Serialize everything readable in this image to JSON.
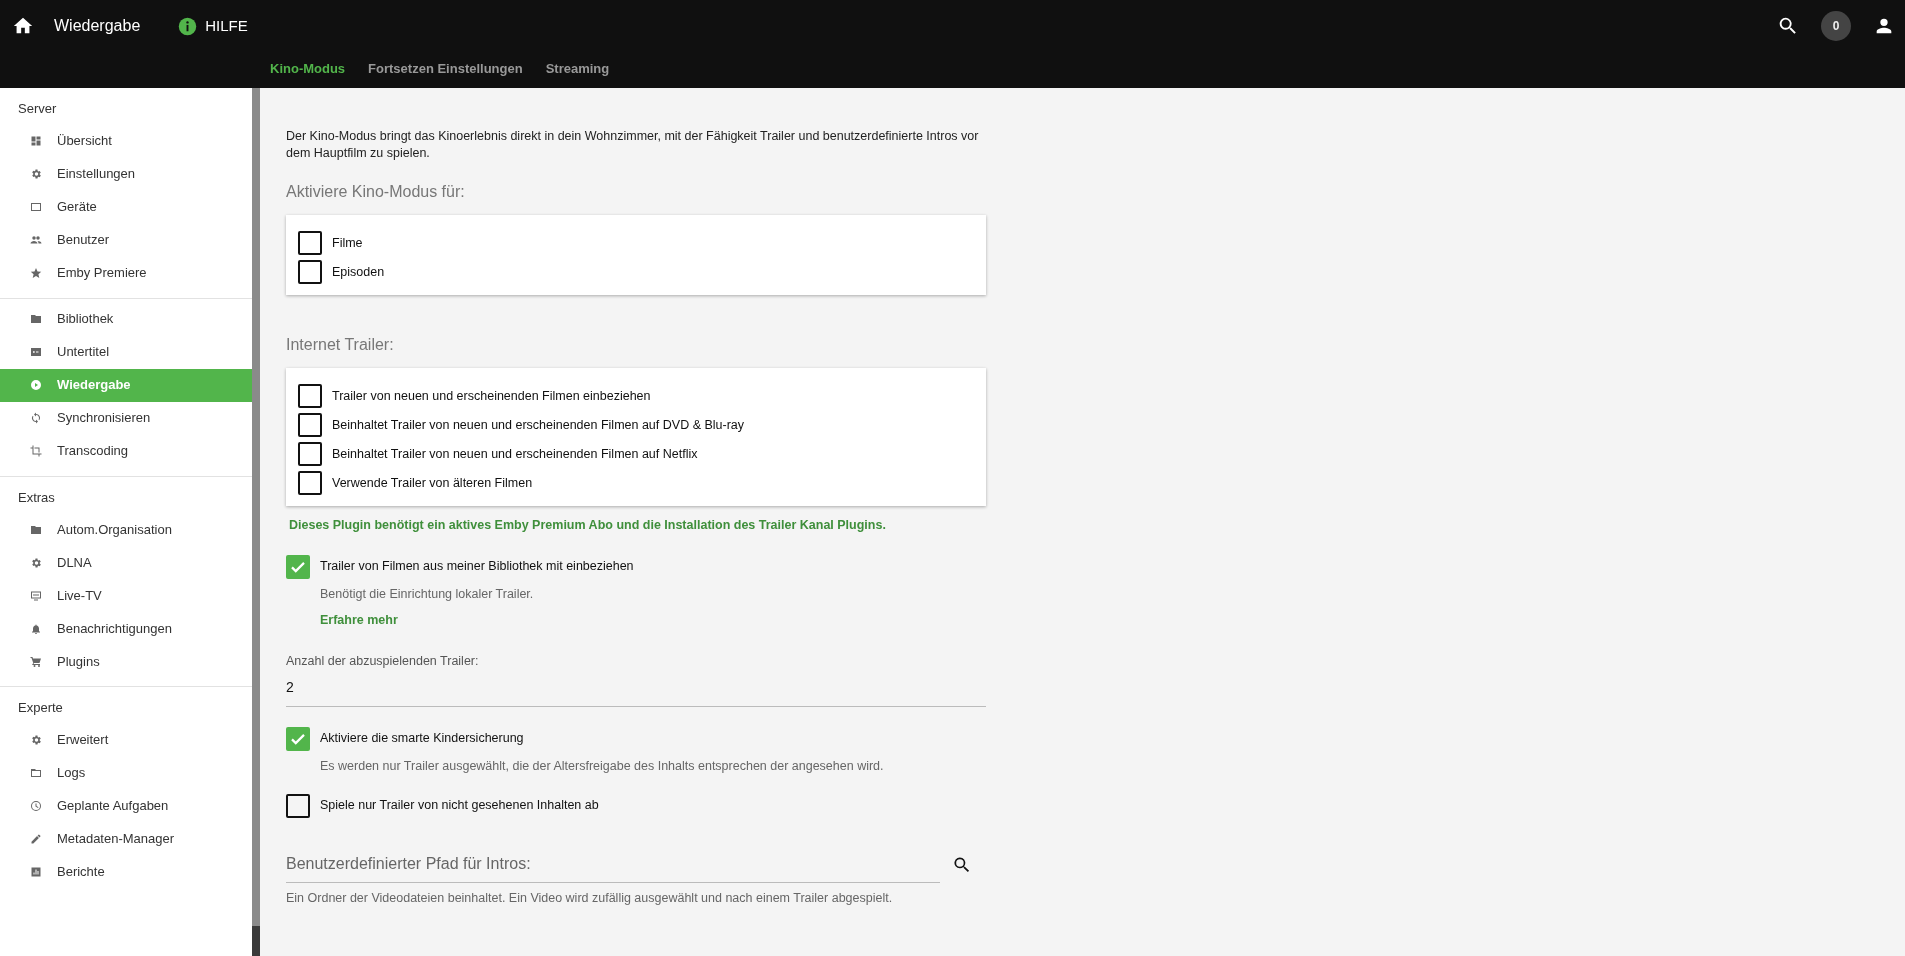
{
  "header": {
    "title": "Wiedergabe",
    "help": "HILFE",
    "notification_count": "0"
  },
  "tabs": [
    {
      "label": "Kino-Modus",
      "selected": true
    },
    {
      "label": "Fortsetzen Einstellungen",
      "selected": false
    },
    {
      "label": "Streaming",
      "selected": false
    }
  ],
  "sidebar": {
    "sections": [
      {
        "title": "Server",
        "items": [
          {
            "label": "Übersicht",
            "selected": false
          },
          {
            "label": "Einstellungen",
            "selected": false
          },
          {
            "label": "Geräte",
            "selected": false
          },
          {
            "label": "Benutzer",
            "selected": false
          },
          {
            "label": "Emby Premiere",
            "selected": false
          }
        ]
      },
      {
        "items": [
          {
            "label": "Bibliothek",
            "selected": false
          },
          {
            "label": "Untertitel",
            "selected": false
          },
          {
            "label": "Wiedergabe",
            "selected": true
          },
          {
            "label": "Synchronisieren",
            "selected": false
          },
          {
            "label": "Transcoding",
            "selected": false
          }
        ]
      },
      {
        "title": "Extras",
        "items": [
          {
            "label": "Autom.Organisation",
            "selected": false
          },
          {
            "label": "DLNA",
            "selected": false
          },
          {
            "label": "Live-TV",
            "selected": false
          },
          {
            "label": "Benachrichtigungen",
            "selected": false
          },
          {
            "label": "Plugins",
            "selected": false
          }
        ]
      },
      {
        "title": "Experte",
        "items": [
          {
            "label": "Erweitert",
            "selected": false
          },
          {
            "label": "Logs",
            "selected": false
          },
          {
            "label": "Geplante Aufgaben",
            "selected": false
          },
          {
            "label": "Metadaten-Manager",
            "selected": false
          },
          {
            "label": "Berichte",
            "selected": false
          }
        ]
      }
    ]
  },
  "intro": "Der Kino-Modus bringt das Kinoerlebnis direkt in dein Wohnzimmer, mit der Fähigkeit Trailer und benutzerdefinierte Intros vor dem Hauptfilm zu spielen.",
  "groups": [
    {
      "heading": "Aktiviere Kino-Modus für:",
      "options": [
        {
          "label": "Filme",
          "checked": false
        },
        {
          "label": "Episoden",
          "checked": false
        }
      ]
    },
    {
      "heading": "Internet Trailer:",
      "options": [
        {
          "label": "Trailer von neuen und erscheinenden Filmen einbeziehen",
          "checked": false
        },
        {
          "label": "Beinhaltet Trailer von neuen und erscheinenden Filmen auf DVD & Blu-ray",
          "checked": false
        },
        {
          "label": "Beinhaltet Trailer von neuen und erscheinenden Filmen auf Netflix",
          "checked": false
        },
        {
          "label": "Verwende Trailer von älteren Filmen",
          "checked": false
        }
      ],
      "note": "Dieses Plugin benötigt ein aktives Emby Premium Abo und die Installation des Trailer Kanal Plugins."
    }
  ],
  "settings": [
    {
      "kind": "checkbox",
      "label": "Trailer von Filmen aus meiner Bibliothek mit einbeziehen",
      "checked": true,
      "description": "Benötigt die Einrichtung lokaler Trailer.",
      "link": "Erfahre mehr"
    },
    {
      "kind": "field",
      "label": "Anzahl der abzuspielenden Trailer:",
      "value": "2"
    },
    {
      "kind": "checkbox",
      "label": "Aktiviere die smarte Kindersicherung",
      "checked": true,
      "description": "Es werden nur Trailer ausgewählt, die der Altersfreigabe des Inhalts entsprechen der angesehen wird."
    },
    {
      "kind": "checkbox",
      "label": "Spiele nur Trailer von nicht gesehenen Inhalten ab",
      "checked": false
    },
    {
      "kind": "path",
      "placeholder": "Benutzerdefinierter Pfad für Intros:",
      "description": "Ein Ordner der Videodateien beinhaltet. Ein Video wird zufällig ausgewählt und nach einem Trailer abgespielt."
    }
  ]
}
